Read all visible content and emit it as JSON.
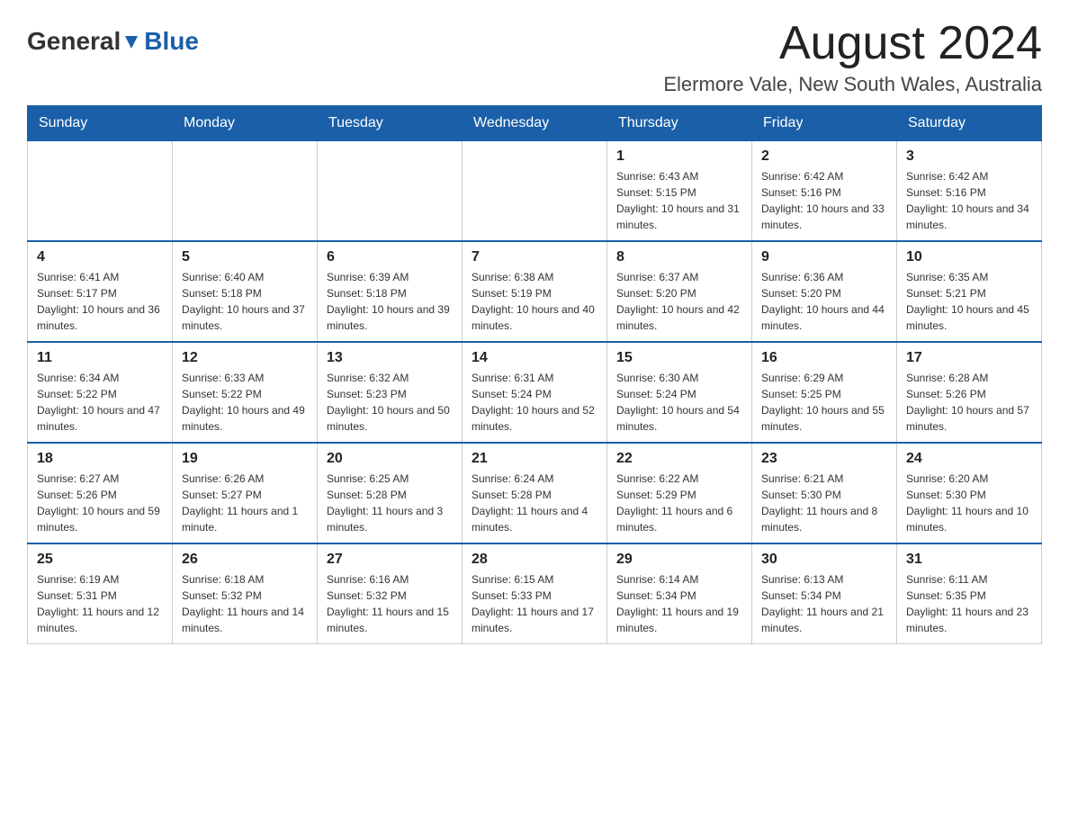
{
  "logo": {
    "text_general": "General",
    "text_blue": "Blue"
  },
  "header": {
    "month_year": "August 2024",
    "location": "Elermore Vale, New South Wales, Australia"
  },
  "days_of_week": [
    "Sunday",
    "Monday",
    "Tuesday",
    "Wednesday",
    "Thursday",
    "Friday",
    "Saturday"
  ],
  "weeks": [
    [
      {
        "day": "",
        "info": ""
      },
      {
        "day": "",
        "info": ""
      },
      {
        "day": "",
        "info": ""
      },
      {
        "day": "",
        "info": ""
      },
      {
        "day": "1",
        "info": "Sunrise: 6:43 AM\nSunset: 5:15 PM\nDaylight: 10 hours and 31 minutes."
      },
      {
        "day": "2",
        "info": "Sunrise: 6:42 AM\nSunset: 5:16 PM\nDaylight: 10 hours and 33 minutes."
      },
      {
        "day": "3",
        "info": "Sunrise: 6:42 AM\nSunset: 5:16 PM\nDaylight: 10 hours and 34 minutes."
      }
    ],
    [
      {
        "day": "4",
        "info": "Sunrise: 6:41 AM\nSunset: 5:17 PM\nDaylight: 10 hours and 36 minutes."
      },
      {
        "day": "5",
        "info": "Sunrise: 6:40 AM\nSunset: 5:18 PM\nDaylight: 10 hours and 37 minutes."
      },
      {
        "day": "6",
        "info": "Sunrise: 6:39 AM\nSunset: 5:18 PM\nDaylight: 10 hours and 39 minutes."
      },
      {
        "day": "7",
        "info": "Sunrise: 6:38 AM\nSunset: 5:19 PM\nDaylight: 10 hours and 40 minutes."
      },
      {
        "day": "8",
        "info": "Sunrise: 6:37 AM\nSunset: 5:20 PM\nDaylight: 10 hours and 42 minutes."
      },
      {
        "day": "9",
        "info": "Sunrise: 6:36 AM\nSunset: 5:20 PM\nDaylight: 10 hours and 44 minutes."
      },
      {
        "day": "10",
        "info": "Sunrise: 6:35 AM\nSunset: 5:21 PM\nDaylight: 10 hours and 45 minutes."
      }
    ],
    [
      {
        "day": "11",
        "info": "Sunrise: 6:34 AM\nSunset: 5:22 PM\nDaylight: 10 hours and 47 minutes."
      },
      {
        "day": "12",
        "info": "Sunrise: 6:33 AM\nSunset: 5:22 PM\nDaylight: 10 hours and 49 minutes."
      },
      {
        "day": "13",
        "info": "Sunrise: 6:32 AM\nSunset: 5:23 PM\nDaylight: 10 hours and 50 minutes."
      },
      {
        "day": "14",
        "info": "Sunrise: 6:31 AM\nSunset: 5:24 PM\nDaylight: 10 hours and 52 minutes."
      },
      {
        "day": "15",
        "info": "Sunrise: 6:30 AM\nSunset: 5:24 PM\nDaylight: 10 hours and 54 minutes."
      },
      {
        "day": "16",
        "info": "Sunrise: 6:29 AM\nSunset: 5:25 PM\nDaylight: 10 hours and 55 minutes."
      },
      {
        "day": "17",
        "info": "Sunrise: 6:28 AM\nSunset: 5:26 PM\nDaylight: 10 hours and 57 minutes."
      }
    ],
    [
      {
        "day": "18",
        "info": "Sunrise: 6:27 AM\nSunset: 5:26 PM\nDaylight: 10 hours and 59 minutes."
      },
      {
        "day": "19",
        "info": "Sunrise: 6:26 AM\nSunset: 5:27 PM\nDaylight: 11 hours and 1 minute."
      },
      {
        "day": "20",
        "info": "Sunrise: 6:25 AM\nSunset: 5:28 PM\nDaylight: 11 hours and 3 minutes."
      },
      {
        "day": "21",
        "info": "Sunrise: 6:24 AM\nSunset: 5:28 PM\nDaylight: 11 hours and 4 minutes."
      },
      {
        "day": "22",
        "info": "Sunrise: 6:22 AM\nSunset: 5:29 PM\nDaylight: 11 hours and 6 minutes."
      },
      {
        "day": "23",
        "info": "Sunrise: 6:21 AM\nSunset: 5:30 PM\nDaylight: 11 hours and 8 minutes."
      },
      {
        "day": "24",
        "info": "Sunrise: 6:20 AM\nSunset: 5:30 PM\nDaylight: 11 hours and 10 minutes."
      }
    ],
    [
      {
        "day": "25",
        "info": "Sunrise: 6:19 AM\nSunset: 5:31 PM\nDaylight: 11 hours and 12 minutes."
      },
      {
        "day": "26",
        "info": "Sunrise: 6:18 AM\nSunset: 5:32 PM\nDaylight: 11 hours and 14 minutes."
      },
      {
        "day": "27",
        "info": "Sunrise: 6:16 AM\nSunset: 5:32 PM\nDaylight: 11 hours and 15 minutes."
      },
      {
        "day": "28",
        "info": "Sunrise: 6:15 AM\nSunset: 5:33 PM\nDaylight: 11 hours and 17 minutes."
      },
      {
        "day": "29",
        "info": "Sunrise: 6:14 AM\nSunset: 5:34 PM\nDaylight: 11 hours and 19 minutes."
      },
      {
        "day": "30",
        "info": "Sunrise: 6:13 AM\nSunset: 5:34 PM\nDaylight: 11 hours and 21 minutes."
      },
      {
        "day": "31",
        "info": "Sunrise: 6:11 AM\nSunset: 5:35 PM\nDaylight: 11 hours and 23 minutes."
      }
    ]
  ]
}
